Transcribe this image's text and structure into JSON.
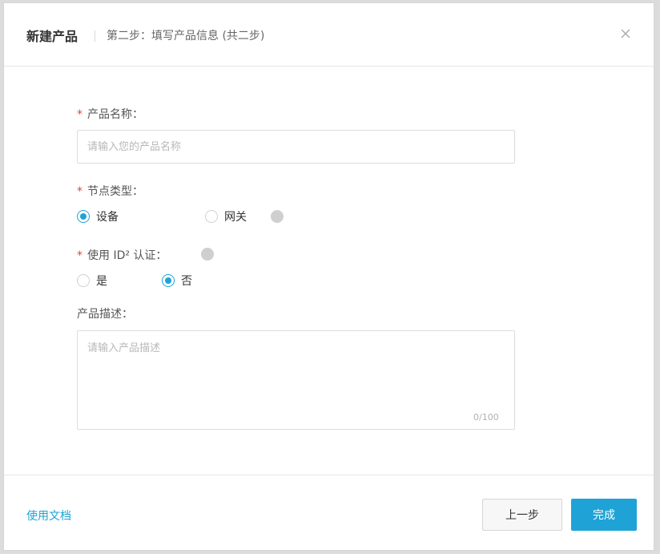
{
  "dialog": {
    "title": "新建产品",
    "subtitle": "第二步：填写产品信息 (共二步)"
  },
  "form": {
    "product_name": {
      "required_mark": "*",
      "label": "产品名称：",
      "placeholder": "请输入您的产品名称",
      "value": ""
    },
    "node_type": {
      "required_mark": "*",
      "label": "节点类型：",
      "options": [
        "设备",
        "网关"
      ],
      "selected": "设备",
      "help_icon": "question-circle-icon"
    },
    "id2_auth": {
      "required_mark": "*",
      "label": "使用 ID² 认证：",
      "options": [
        "是",
        "否"
      ],
      "selected": "否",
      "help_icon": "question-circle-icon"
    },
    "description": {
      "label": "产品描述：",
      "placeholder": "请输入产品描述",
      "value": "",
      "counter": "0/100"
    }
  },
  "footer": {
    "doc_link": "使用文档",
    "prev_button": "上一步",
    "done_button": "完成"
  },
  "colors": {
    "accent": "#1fa3d6",
    "required": "#e0443a"
  }
}
